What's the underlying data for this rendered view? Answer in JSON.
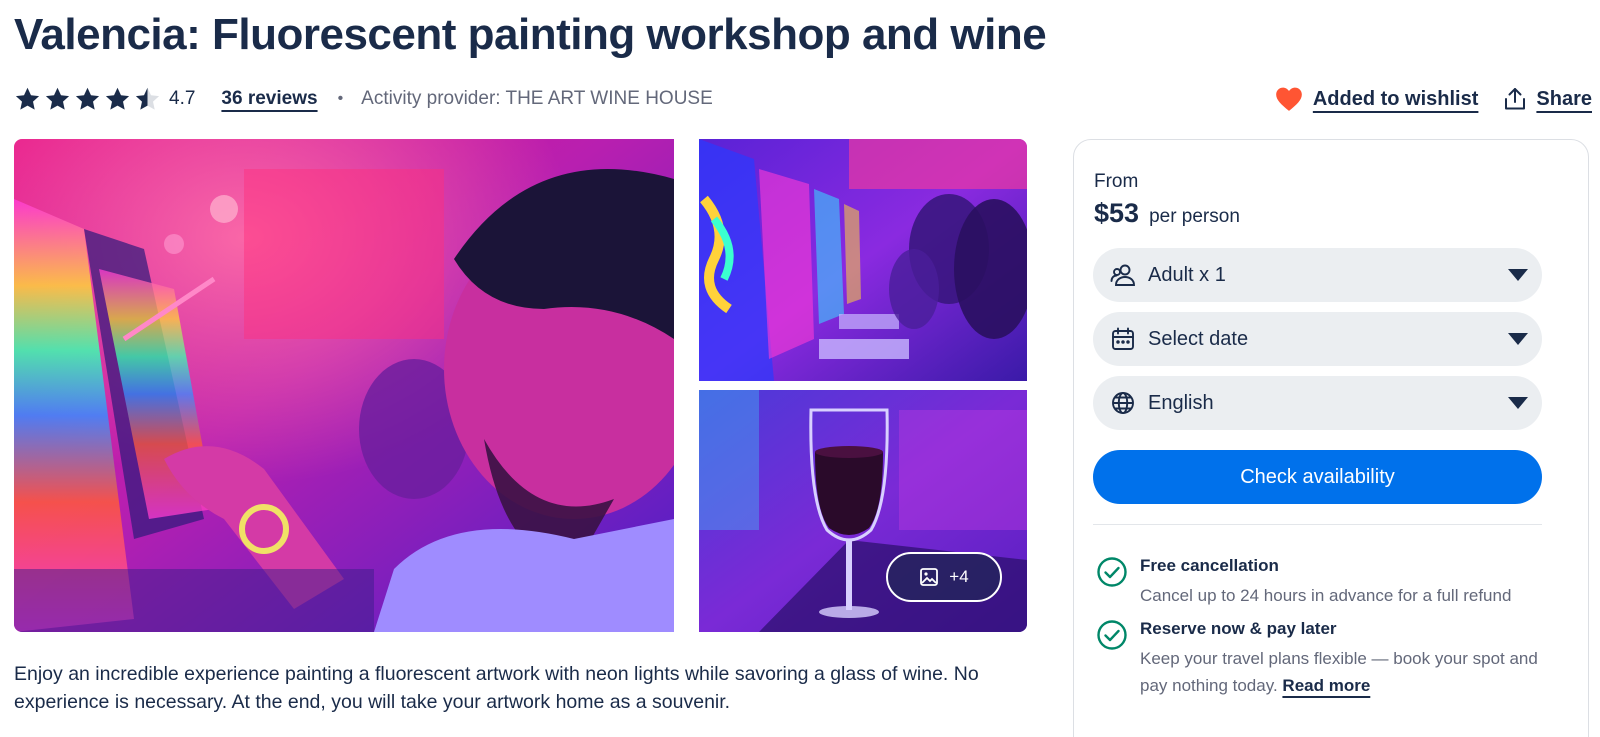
{
  "activity": {
    "title": "Valencia: Fluorescent painting workshop and wine",
    "rating": "4.7",
    "rating_value": 4.7,
    "rating_max": 5,
    "reviews_label": "36 reviews",
    "separator": "•",
    "provider": "Activity provider: THE ART WINE HOUSE",
    "description": "Enjoy an incredible experience painting a fluorescent artwork with neon lights while savoring a glass of wine. No experience is necessary. At the end, you will take your artwork home as a souvenir."
  },
  "actions": {
    "wishlist_label": "Added to wishlist",
    "share_label": "Share"
  },
  "gallery": {
    "more_photos_label": "+4"
  },
  "booking": {
    "from_label": "From",
    "price": "$53",
    "per_label": "per person",
    "participants": "Adult x 1",
    "date_placeholder": "Select date",
    "language": "English",
    "cta_label": "Check availability"
  },
  "benefits": [
    {
      "title": "Free cancellation",
      "text": "Cancel up to 24 hours in advance for a full refund"
    },
    {
      "title": "Reserve now & pay later",
      "text": "Keep your travel plans flexible — book your spot and pay nothing today.",
      "link": "Read more"
    }
  ],
  "colors": {
    "text_dark": "#1a2b49",
    "text_muted": "#63687a",
    "accent_blue": "#0071eb",
    "heart_orange": "#ff5533",
    "check_green": "#008768",
    "select_bg": "#ebeef1"
  }
}
